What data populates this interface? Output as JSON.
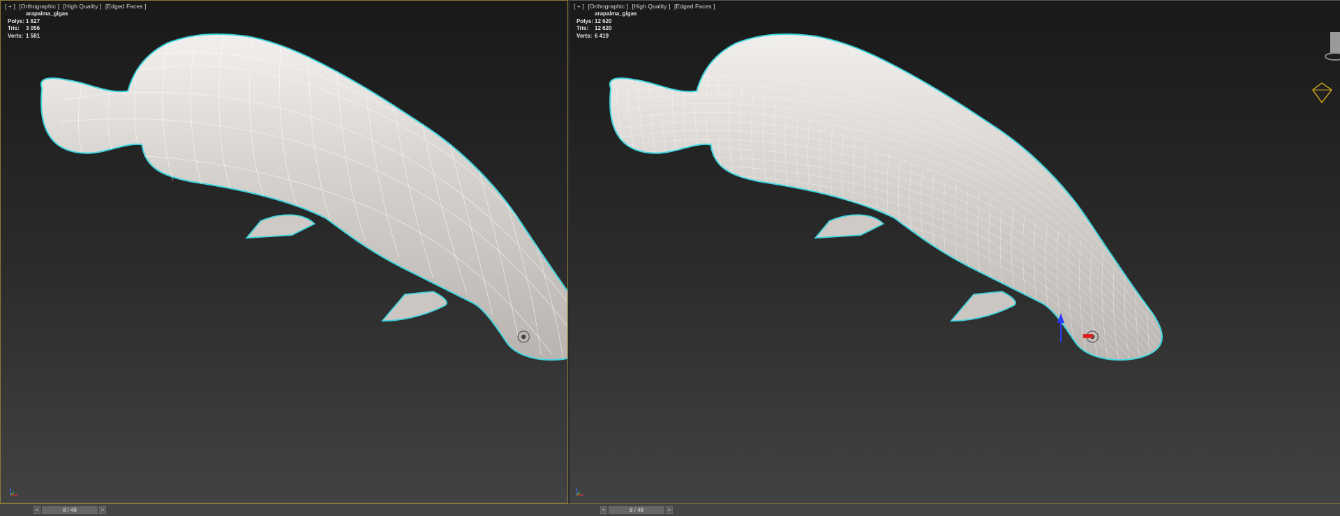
{
  "viewports": {
    "left": {
      "labels": [
        "[ + ]",
        "[Orthographic ]",
        "[High Quality ]",
        "[Edged Faces ]"
      ],
      "stats": {
        "object": "arapaima_gigas",
        "polys_label": "Polys:",
        "polys": "1 627",
        "tris_label": "Tris:",
        "tris": "3 056",
        "verts_label": "Verts:",
        "verts": "1 581"
      }
    },
    "right": {
      "labels": [
        "[ + ]",
        "[Orthographic ]",
        "[High Quality ]",
        "[Edged Faces ]"
      ],
      "stats": {
        "object": "arapaima_gigas",
        "polys_label": "Polys:",
        "polys": "12 620",
        "tris_label": "Tris:",
        "tris": "12 620",
        "verts_label": "Verts:",
        "verts": "6 419"
      }
    }
  },
  "footer": {
    "left_pager": {
      "prev": "<",
      "page": "8 / 48",
      "next": ">"
    },
    "right_pager": {
      "prev": "<",
      "page": "8 / 48",
      "next": ">"
    }
  },
  "gizmo": {
    "z_label": "z"
  },
  "colors": {
    "selection_outline": "#3fd6e0",
    "viewport_border": "#8a7a3a",
    "mesh_fill": "#c9c5c2",
    "wire": "#ffffff"
  },
  "icons": [
    "axis-tripod-icon",
    "view-cube-icon",
    "camera-icon",
    "move-gizmo-icon"
  ]
}
